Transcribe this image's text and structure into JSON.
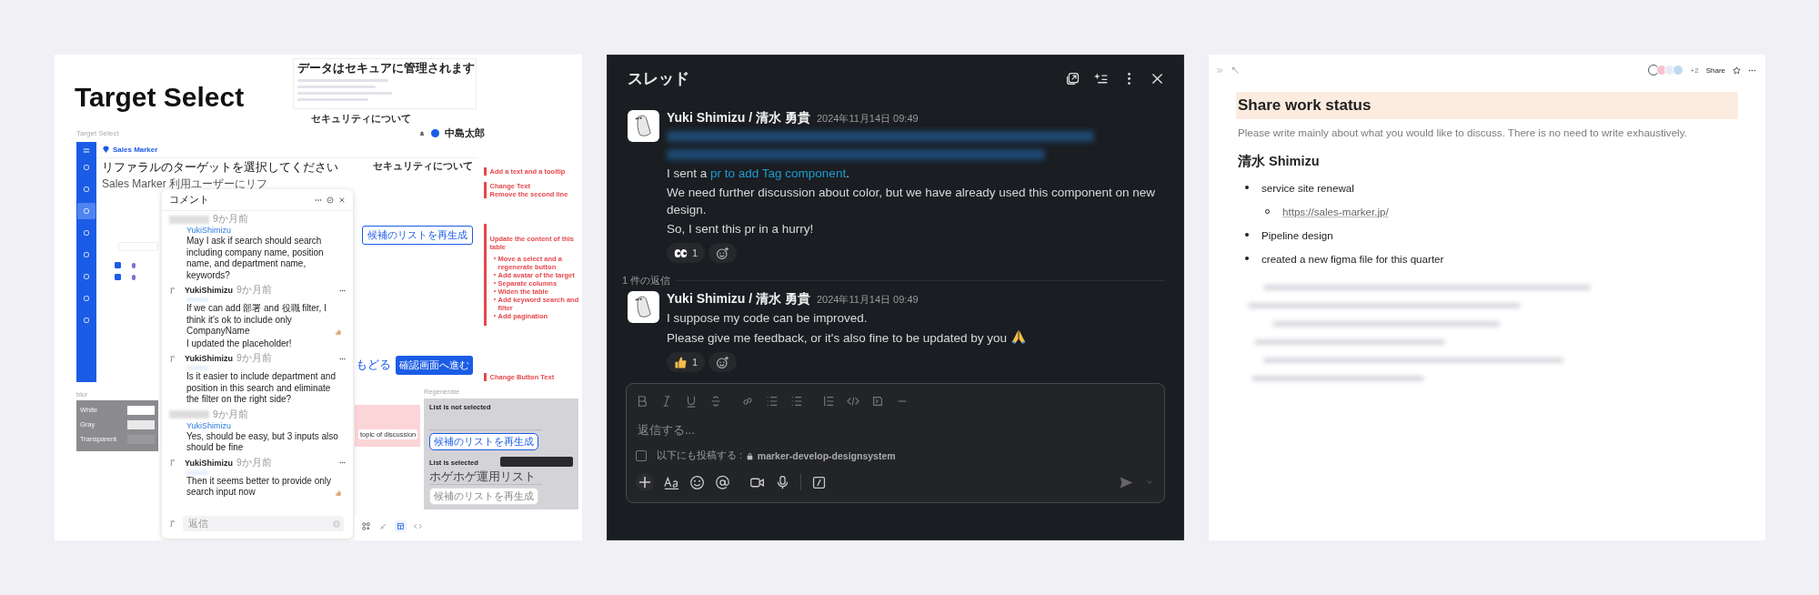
{
  "canvas": {
    "title": "Target Select",
    "frame_label": "Target Select",
    "mockup": {
      "logo": "Sales Marker",
      "heading": "リファラルのターゲットを選択してください",
      "subtext": "Sales Marker 利用ユーザーにリフ",
      "security_link": "セキュリティについて",
      "regenerate_button": "候補のリストを再生成",
      "back_link": "もどる",
      "next_button": "確認画面へ進む",
      "nav_items": [
        {
          "selected": false
        },
        {
          "selected": false
        },
        {
          "selected": true
        },
        {
          "selected": false
        },
        {
          "selected": false
        },
        {
          "selected": false
        },
        {
          "selected": false
        },
        {
          "selected": false
        }
      ],
      "rows": [
        {
          "checked": true
        },
        {
          "checked": true
        }
      ]
    },
    "security_card": {
      "title": "データはセキュアに管理されます",
      "link": "セキュリティについて",
      "user_name": "中島太郎"
    },
    "blur_sample": {
      "label": "blur",
      "rows": [
        "White",
        "Gray",
        "Transparent"
      ]
    },
    "sticky": {
      "chip": "topic of discussion"
    },
    "regenerate": {
      "label": "Regenerate",
      "not_selected_label": "List is not selected",
      "selected_label": "List is selected",
      "select_value": "ホゲホゲ運用リスト",
      "button": "候補のリストを再生成",
      "disabled_button": "候補のリストを再生成"
    },
    "annotations": [
      {
        "kind": "note",
        "lines": [
          "Add a text and a tooltip"
        ]
      },
      {
        "kind": "note",
        "lines": [
          "Change Text",
          "Remove the second line"
        ]
      },
      {
        "kind": "list",
        "title": "Update the content of this table",
        "bullets": [
          "Move a select and a regenerate button",
          "Add avatar of the target",
          "Separate columns",
          "Widen the table",
          "Add keyword search and filter",
          "Add pagination"
        ]
      },
      {
        "kind": "note",
        "lines": [
          "Change Button Text"
        ]
      }
    ],
    "comments": {
      "title": "コメント",
      "reply_placeholder": "返信",
      "items": [
        {
          "kind": "mention",
          "time": "9か月前",
          "author": "YukiShimizu",
          "lines": [
            {
              "kind": "plain",
              "text": "May I ask if search should search including company name, position name, and department name, keywords?"
            }
          ]
        },
        {
          "kind": "authored",
          "time": "9か月前",
          "author": "YukiShimizu",
          "lines": [
            {
              "kind": "thumbs",
              "text": "If we can add 部署 and 役職 filter, I think it's ok to include only CompanyName"
            },
            {
              "kind": "plain",
              "text": "I updated the placeholder!"
            }
          ]
        },
        {
          "kind": "authored",
          "time": "9か月前",
          "author": "YukiShimizu",
          "lines": [
            {
              "kind": "plain",
              "text": "Is it easier to include department and position in this search and eliminate the filter on the right side?"
            }
          ]
        },
        {
          "kind": "mention",
          "time": "9か月前",
          "author": "YukiShimizu",
          "lines": [
            {
              "kind": "plain",
              "text": "Yes, should be easy, but 3 inputs also should be fine"
            }
          ]
        },
        {
          "kind": "authored",
          "time": "9か月前",
          "author": "YukiShimizu",
          "lines": [
            {
              "kind": "thumbs",
              "text": "Then it seems better to provide only search input now"
            }
          ]
        }
      ]
    }
  },
  "thread": {
    "title": "スレッド",
    "messages": [
      {
        "author": "Yuki Shimizu / 清水 勇貴",
        "time": "2024年11月14日 09:49",
        "redacted_lines": true,
        "paragraphs": [
          {
            "kind": "link",
            "text": "I sent a",
            "link": "pr to add Tag component",
            "after": "."
          },
          {
            "kind": "plain",
            "text": "We need further discussion about color, but we have already used this component on new design."
          },
          {
            "kind": "plain",
            "text": "So, I sent this pr in a hurry!"
          }
        ],
        "reactions": [
          {
            "kind": "eyes",
            "count": "1"
          }
        ]
      },
      {
        "author": "Yuki Shimizu / 清水 勇貴",
        "time": "2024年11月14日 09:49",
        "redacted_lines": false,
        "paragraphs": [
          {
            "kind": "plain",
            "text": "I suppose my code can be improved."
          },
          {
            "kind": "pray",
            "text": "Please give me feedback, or it's also fine to be updated by you"
          }
        ],
        "reactions": [
          {
            "kind": "thumbs",
            "count": "1"
          }
        ]
      }
    ],
    "reply_count": "1 件の返信",
    "composer": {
      "placeholder": "返信する...",
      "also_post_label": "以下にも投稿する :",
      "channel": "marker-develop-designsystem",
      "also_post_checked": false
    }
  },
  "doc": {
    "viewer_extra": "+2",
    "share": "Share",
    "title": "Share work status",
    "description": "Please write mainly about what you would like to discuss. There is no need to write exhaustively.",
    "heading": "清水 Shimizu",
    "items": [
      {
        "text": "service site renewal",
        "children": [
          {
            "text": "https://sales-marker.jp/"
          }
        ]
      },
      {
        "text": "Pipeline design"
      },
      {
        "text": "created a new figma file for this quarter"
      }
    ]
  }
}
